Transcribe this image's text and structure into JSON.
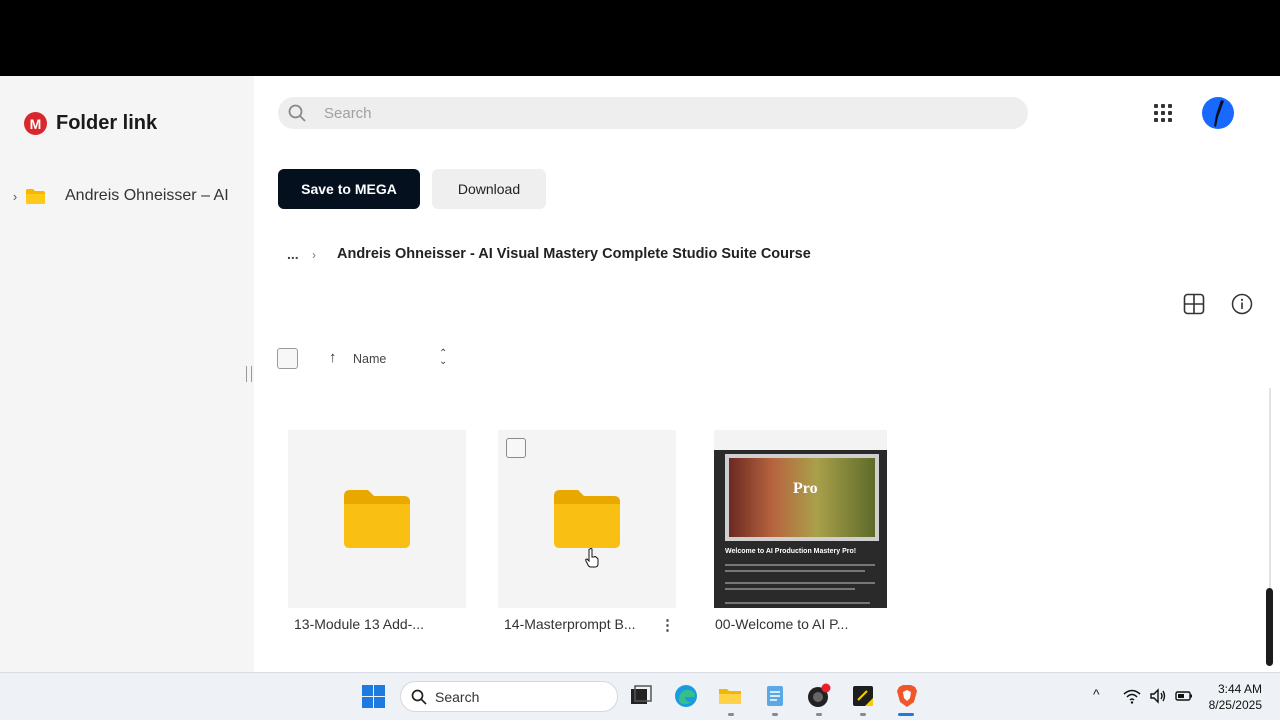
{
  "sidebar": {
    "brand_title": "Folder link",
    "tree_item_label": "Andreis Ohneisser – AI"
  },
  "header": {
    "search_placeholder": "Search"
  },
  "actions": {
    "save_label": "Save to MEGA",
    "download_label": "Download"
  },
  "breadcrumb": {
    "more": "...",
    "current": "Andreis Ohneisser - AI Visual Mastery Complete Studio Suite Course"
  },
  "sort": {
    "label": "Name"
  },
  "items": [
    {
      "label": "13-Module 13 Add-...",
      "type": "folder"
    },
    {
      "label": "14-Masterprompt B...",
      "type": "folder"
    },
    {
      "label": "00-Welcome to AI P...",
      "type": "file",
      "thumb_title": "Welcome to AI Production Mastery Pro!",
      "thumb_word": "Pro"
    }
  ],
  "taskbar": {
    "search_label": "Search",
    "time": "3:44 AM",
    "date": "8/25/2025"
  },
  "colors": {
    "brand_red": "#d9272e",
    "primary_button": "#04101e",
    "folder_yellow": "#f5b800",
    "windows_blue": "#1f7ae0"
  }
}
